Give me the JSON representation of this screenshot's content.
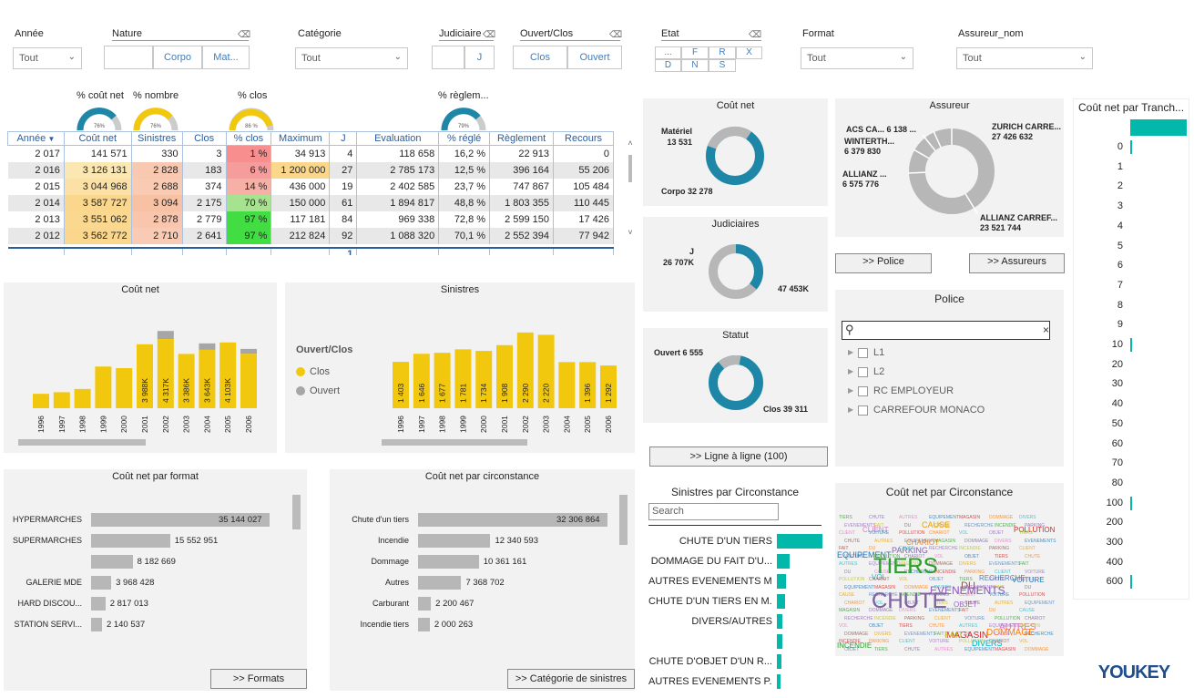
{
  "slicers": {
    "annee": {
      "label": "Année",
      "value": "Tout"
    },
    "nature": {
      "label": "Nature",
      "options": [
        "",
        "Corpo",
        "Mat..."
      ]
    },
    "categorie": {
      "label": "Catégorie",
      "value": "Tout"
    },
    "judiciaire": {
      "label": "Judiciaire",
      "options": [
        "",
        "J"
      ]
    },
    "ouvert_clos": {
      "label": "Ouvert/Clos",
      "options": [
        "Clos",
        "Ouvert"
      ]
    },
    "etat": {
      "label": "Etat",
      "options": [
        "...",
        "F",
        "R",
        "X",
        "D",
        "N",
        "S"
      ]
    },
    "format": {
      "label": "Format",
      "value": "Tout"
    },
    "assureur": {
      "label": "Assureur_nom",
      "value": "Tout"
    }
  },
  "gauges": [
    {
      "label": "% coût net",
      "value": "76%",
      "fraction": 0.76,
      "color": "#1e87a8"
    },
    {
      "label": "% nombre",
      "value": "76%",
      "fraction": 0.76,
      "color": "#f2c80f"
    },
    {
      "label": "% clos",
      "value": "86 %",
      "fraction": 0.86,
      "color": "#f2c80f"
    },
    {
      "label": "% règlem...",
      "value": "79%",
      "fraction": 0.79,
      "color": "#1e87a8"
    }
  ],
  "table": {
    "columns": [
      "Année",
      "Coût net",
      "Sinistres",
      "Clos",
      "% clos",
      "Maximum",
      "J",
      "Evaluation",
      "% réglé",
      "Règlement",
      "Recours"
    ],
    "sort_indicator": "▼",
    "rows": [
      [
        "2 017",
        "141 571",
        "330",
        "3",
        "1 %",
        "34 913",
        "4",
        "118 658",
        "16,2 %",
        "22 913",
        "0"
      ],
      [
        "2 016",
        "3 126 131",
        "2 828",
        "183",
        "6 %",
        "1 200 000",
        "27",
        "2 785 173",
        "12,5 %",
        "396 164",
        "55 206"
      ],
      [
        "2 015",
        "3 044 968",
        "2 688",
        "374",
        "14 %",
        "436 000",
        "19",
        "2 402 585",
        "23,7 %",
        "747 867",
        "105 484"
      ],
      [
        "2 014",
        "3 587 727",
        "3 094",
        "2 175",
        "70 %",
        "150 000",
        "61",
        "1 894 817",
        "48,8 %",
        "1 803 355",
        "110 445"
      ],
      [
        "2 013",
        "3 551 062",
        "2 878",
        "2 779",
        "97 %",
        "117 181",
        "84",
        "969 338",
        "72,8 %",
        "2 599 150",
        "17 426"
      ],
      [
        "2 012",
        "3 562 772",
        "2 710",
        "2 641",
        "97 %",
        "212 824",
        "92",
        "1 088 320",
        "70,1 %",
        "2 552 394",
        "77 942"
      ]
    ],
    "total": [
      "Total",
      "74 159 847",
      "45 866",
      "39 311",
      "86 %",
      "1 973 760",
      "1 389",
      "15 966 309",
      "78,9 %",
      "59 779 123",
      "1 585 585"
    ],
    "heat_colors": {
      "cout_net": [
        "#ffffff",
        "#fbe7b1",
        "#fbe1a6",
        "#fbd78e",
        "#fbd88f",
        "#fbd78d"
      ],
      "sinistres": [
        "#ffffff",
        "#f9c8b0",
        "#f9cbb3",
        "#f8c1a3",
        "#f9c6ad",
        "#f9cbb4"
      ],
      "pct_clos": [
        "#f88e8e",
        "#f79c9c",
        "#f7b0a6",
        "#a6e28f",
        "#42dd42",
        "#42dd42"
      ],
      "maximum": [
        "#ffffff",
        "#fbd78b",
        "#ffffff",
        "#ffffff",
        "#ffffff",
        "#ffffff"
      ]
    }
  },
  "cout_net_chart": {
    "title": "Coût net",
    "color_clos": "#f2c80f",
    "color_ouvert": "#a6a6a6"
  },
  "sinistres_chart": {
    "title": "Sinistres",
    "legend_title": "Ouvert/Clos",
    "legend": [
      "Clos",
      "Ouvert"
    ]
  },
  "chart_data": [
    {
      "type": "bar",
      "stacked": true,
      "title": "Coût net",
      "categories": [
        "1996",
        "1997",
        "1998",
        "1999",
        "2000",
        "2001",
        "2002",
        "2003",
        "2004",
        "2005",
        "2006"
      ],
      "series": [
        {
          "name": "Clos",
          "values": [
            0.9,
            1.0,
            1.2,
            2.6,
            2.5,
            3.988,
            4.317,
            3.386,
            3.643,
            4.103,
            3.4
          ]
        },
        {
          "name": "Ouvert",
          "values": [
            0,
            0,
            0,
            0,
            0,
            0,
            0.5,
            0,
            0.4,
            0,
            0.3
          ]
        }
      ],
      "data_labels": [
        "",
        "",
        "",
        "",
        "",
        "3 988K",
        "4 317K",
        "3 386K",
        "3 643K",
        "4 103K",
        ""
      ],
      "ylim": [
        0,
        5
      ]
    },
    {
      "type": "bar",
      "stacked": true,
      "title": "Sinistres",
      "categories": [
        "1996",
        "1997",
        "1998",
        "1999",
        "2000",
        "2001",
        "2002",
        "2003",
        "2004",
        "2005",
        "2006"
      ],
      "series": [
        {
          "name": "Clos",
          "values": [
            1403,
            1646,
            1677,
            1781,
            1734,
            1908,
            2290,
            2220,
            1396,
            1396,
            1292
          ]
        },
        {
          "name": "Ouvert",
          "values": [
            0,
            0,
            0,
            0,
            0,
            0,
            0,
            0,
            0,
            0,
            0
          ]
        }
      ],
      "data_labels": [
        "1 403",
        "1 646",
        "1 677",
        "1 781",
        "1 734",
        "1 908",
        "2 290",
        "2 220",
        "",
        "1 396",
        "1 292"
      ],
      "ylim": [
        0,
        2700
      ]
    },
    {
      "type": "bar",
      "orientation": "horizontal",
      "title": "Coût net par format",
      "categories": [
        "HYPERMARCHES",
        "SUPERMARCHES",
        "",
        "GALERIE MDE",
        "HARD DISCOU...",
        "STATION SERVI..."
      ],
      "values": [
        35144027,
        15552951,
        8182669,
        3968428,
        2817013,
        2140537
      ]
    },
    {
      "type": "bar",
      "orientation": "horizontal",
      "title": "Coût net par circonstance",
      "categories": [
        "Chute d'un tiers",
        "Incendie",
        "Dommage",
        "Autres",
        "Carburant",
        "Incendie tiers"
      ],
      "values": [
        32306864,
        12340593,
        10361161,
        7368702,
        2200467,
        2000263
      ]
    }
  ],
  "format_chart": {
    "title": "Coût net par format",
    "button": ">> Formats",
    "value_labels": [
      "35 144 027",
      "15 552 951",
      "8 182 669",
      "3 968 428",
      "2 817 013",
      "2 140 537"
    ]
  },
  "circonstance_chart": {
    "title": "Coût net par circonstance",
    "button": ">> Catégorie de sinistres",
    "value_labels": [
      "32 306 864",
      "12 340 593",
      "10 361 161",
      "7 368 702",
      "2 200 467",
      "2 000 263"
    ]
  },
  "donut_cout_net": {
    "title": "Coût net",
    "labels": [
      {
        "name": "Matériel",
        "value": "13 531"
      },
      {
        "name": "Corpo",
        "value": "32 278"
      }
    ]
  },
  "donut_judiciaires": {
    "title": "Judiciaires",
    "labels": [
      {
        "name": "J",
        "value": "26 707K"
      },
      {
        "name": "",
        "value": "47 453K"
      }
    ]
  },
  "donut_statut": {
    "title": "Statut",
    "labels": [
      {
        "name": "Ouvert",
        "value": "6 555"
      },
      {
        "name": "Clos",
        "value": "39 311"
      }
    ]
  },
  "assureur_chart": {
    "title": "Assureur",
    "labels": [
      {
        "name": "ACS CA...",
        "value": "6 138 ..."
      },
      {
        "name": "WINTERTH...",
        "value": "6 379 830"
      },
      {
        "name": "ALLIANZ ...",
        "value": "6 575 776"
      },
      {
        "name": "ZURICH CARRE...",
        "value": "27 426 632"
      },
      {
        "name": "ALLIANZ CARREF...",
        "value": "23 521 744"
      }
    ]
  },
  "buttons": {
    "police": ">> Police",
    "assureurs": ">> Assureurs",
    "ligne": ">> Ligne à ligne (100)"
  },
  "police": {
    "title": "Police",
    "items": [
      "L1",
      "L2",
      "RC EMPLOYEUR",
      "CARREFOUR MONACO"
    ]
  },
  "sinistres_circ": {
    "title": "Sinistres par Circonstance",
    "search_placeholder": "Search",
    "items": [
      {
        "label": "CHUTE D'UN TIERS",
        "value": 1.0
      },
      {
        "label": "DOMMAGE DU FAIT D'U...",
        "value": 0.28
      },
      {
        "label": "AUTRES EVENEMENTS M...",
        "value": 0.19
      },
      {
        "label": "CHUTE D'UN TIERS EN M...",
        "value": 0.17
      },
      {
        "label": "DIVERS/AUTRES",
        "value": 0.12
      },
      {
        "label": "",
        "value": 0.11
      },
      {
        "label": "CHUTE D'OBJET D'UN R...",
        "value": 0.09
      },
      {
        "label": "AUTRES EVENEMENTS P...",
        "value": 0.08
      }
    ]
  },
  "wordcloud": {
    "title": "Coût net par Circonstance",
    "words": [
      "TIERS",
      "CHUTE",
      "AUTRES",
      "EQUIPEMENT",
      "MAGASIN",
      "DOMMAGE",
      "DIVERS",
      "EVENEMENTS",
      "FAIT",
      "DU",
      "CAUSE",
      "RECHERCHE",
      "INCENDIE",
      "PARKING",
      "CLIENT",
      "VOITURE",
      "POLLUTION",
      "CHARIOT",
      "VOL",
      "OBJET"
    ],
    "colors": [
      "#2ca02c",
      "#8064a2",
      "#e377c2",
      "#1f77b4",
      "#d62728",
      "#ff7f0e",
      "#17becf",
      "#9467bd",
      "#bcbd22",
      "#8c564b",
      "#e6a000",
      "#4f81bd"
    ]
  },
  "tranche": {
    "title": "Coût net par Tranch...",
    "labels": [
      "0",
      "1",
      "2",
      "3",
      "4",
      "5",
      "6",
      "7",
      "8",
      "9",
      "10",
      "20",
      "30",
      "40",
      "50",
      "60",
      "70",
      "80",
      "100",
      "200",
      "300",
      "400",
      "600"
    ],
    "has_bar": [
      true,
      false,
      false,
      false,
      false,
      false,
      false,
      false,
      false,
      false,
      true,
      false,
      false,
      false,
      false,
      false,
      false,
      false,
      true,
      false,
      false,
      false,
      true
    ]
  },
  "logo": "YOUKEY"
}
